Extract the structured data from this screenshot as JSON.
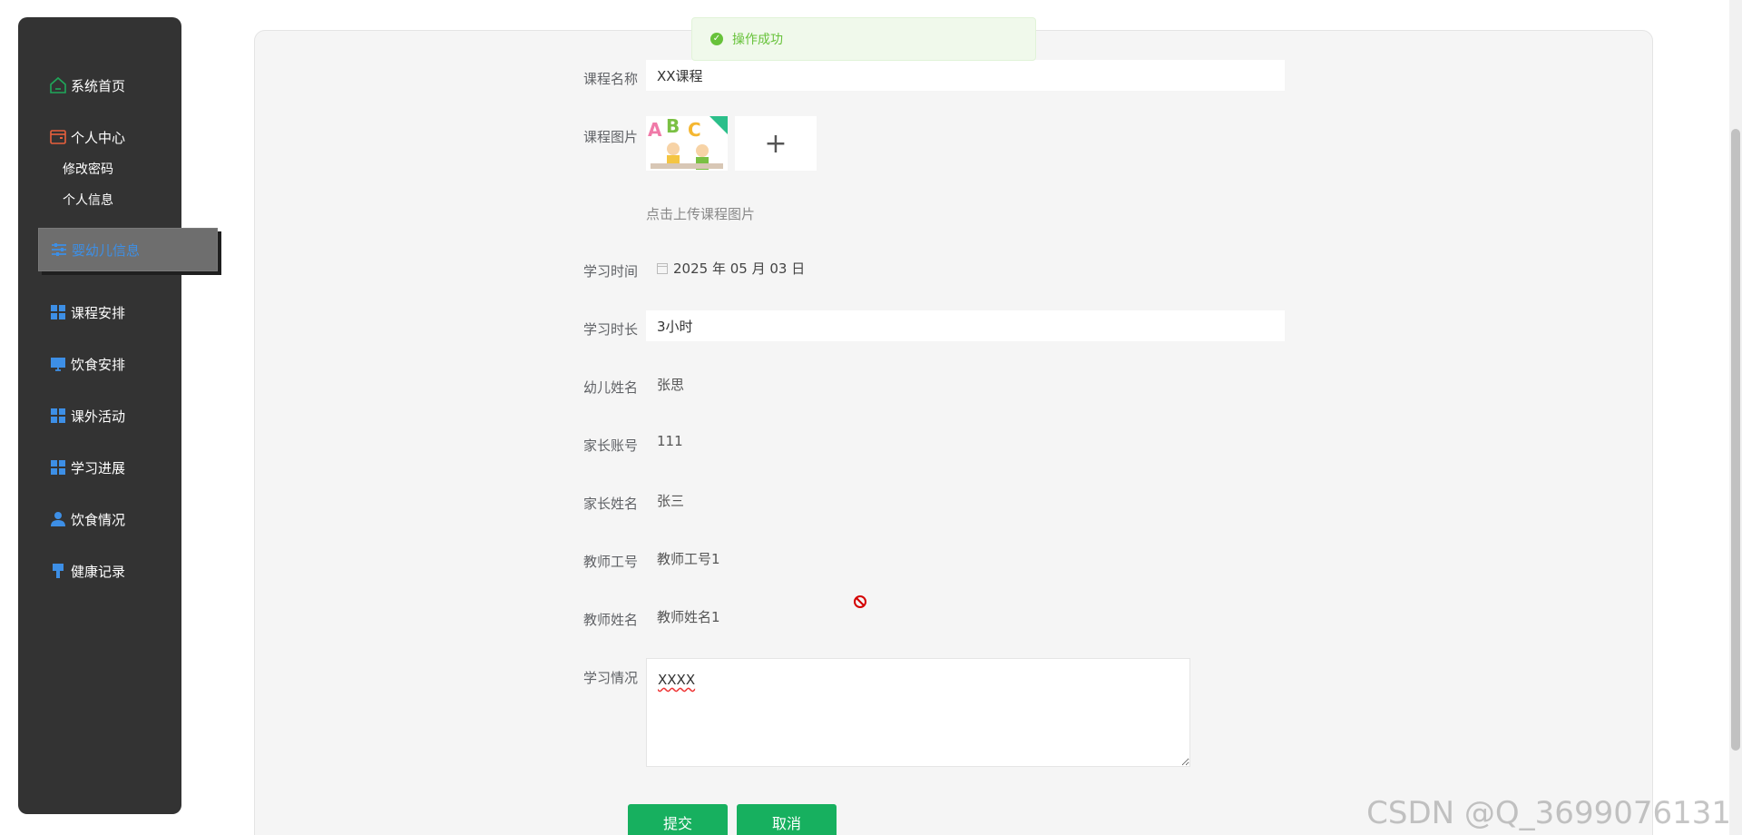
{
  "sidebar": {
    "items": [
      {
        "label": "系统首页",
        "icon": "home-icon",
        "color": "#1fa85a"
      },
      {
        "label": "个人中心",
        "icon": "wallet-icon",
        "color": "#e8603c"
      },
      {
        "label": "婴幼儿信息",
        "icon": "sliders-icon",
        "color": "#3d8fe6"
      },
      {
        "label": "课程安排",
        "icon": "grid-icon",
        "color": "#3d8fe6"
      },
      {
        "label": "饮食安排",
        "icon": "monitor-icon",
        "color": "#3d8fe6"
      },
      {
        "label": "课外活动",
        "icon": "grid-icon",
        "color": "#3d8fe6"
      },
      {
        "label": "学习进展",
        "icon": "grid-icon",
        "color": "#3d8fe6"
      },
      {
        "label": "饮食情况",
        "icon": "user-icon",
        "color": "#3d8fe6"
      },
      {
        "label": "健康记录",
        "icon": "brush-icon",
        "color": "#3d8fe6"
      }
    ],
    "sub_items": [
      "修改密码",
      "个人信息"
    ]
  },
  "toast": {
    "message": "操作成功",
    "color": "#67c23a"
  },
  "form": {
    "course_name": {
      "label": "课程名称",
      "value": "XX课程"
    },
    "course_image": {
      "label": "课程图片",
      "tip": "点击上传课程图片",
      "upload_symbol": "+"
    },
    "study_time": {
      "label": "学习时间",
      "value": "2025 年 05 月 03 日"
    },
    "study_duration": {
      "label": "学习时长",
      "value": "3小时"
    },
    "child_name": {
      "label": "幼儿姓名",
      "value": "张思"
    },
    "parent_account": {
      "label": "家长账号",
      "value": "111"
    },
    "parent_name": {
      "label": "家长姓名",
      "value": "张三"
    },
    "teacher_id": {
      "label": "教师工号",
      "value": "教师工号1"
    },
    "teacher_name": {
      "label": "教师姓名",
      "value": "教师姓名1"
    },
    "study_status": {
      "label": "学习情况",
      "value": "XXXX"
    }
  },
  "buttons": {
    "submit": "提交",
    "cancel": "取消",
    "color": "#17b05f"
  },
  "watermark": "CSDN @Q_3699076131"
}
